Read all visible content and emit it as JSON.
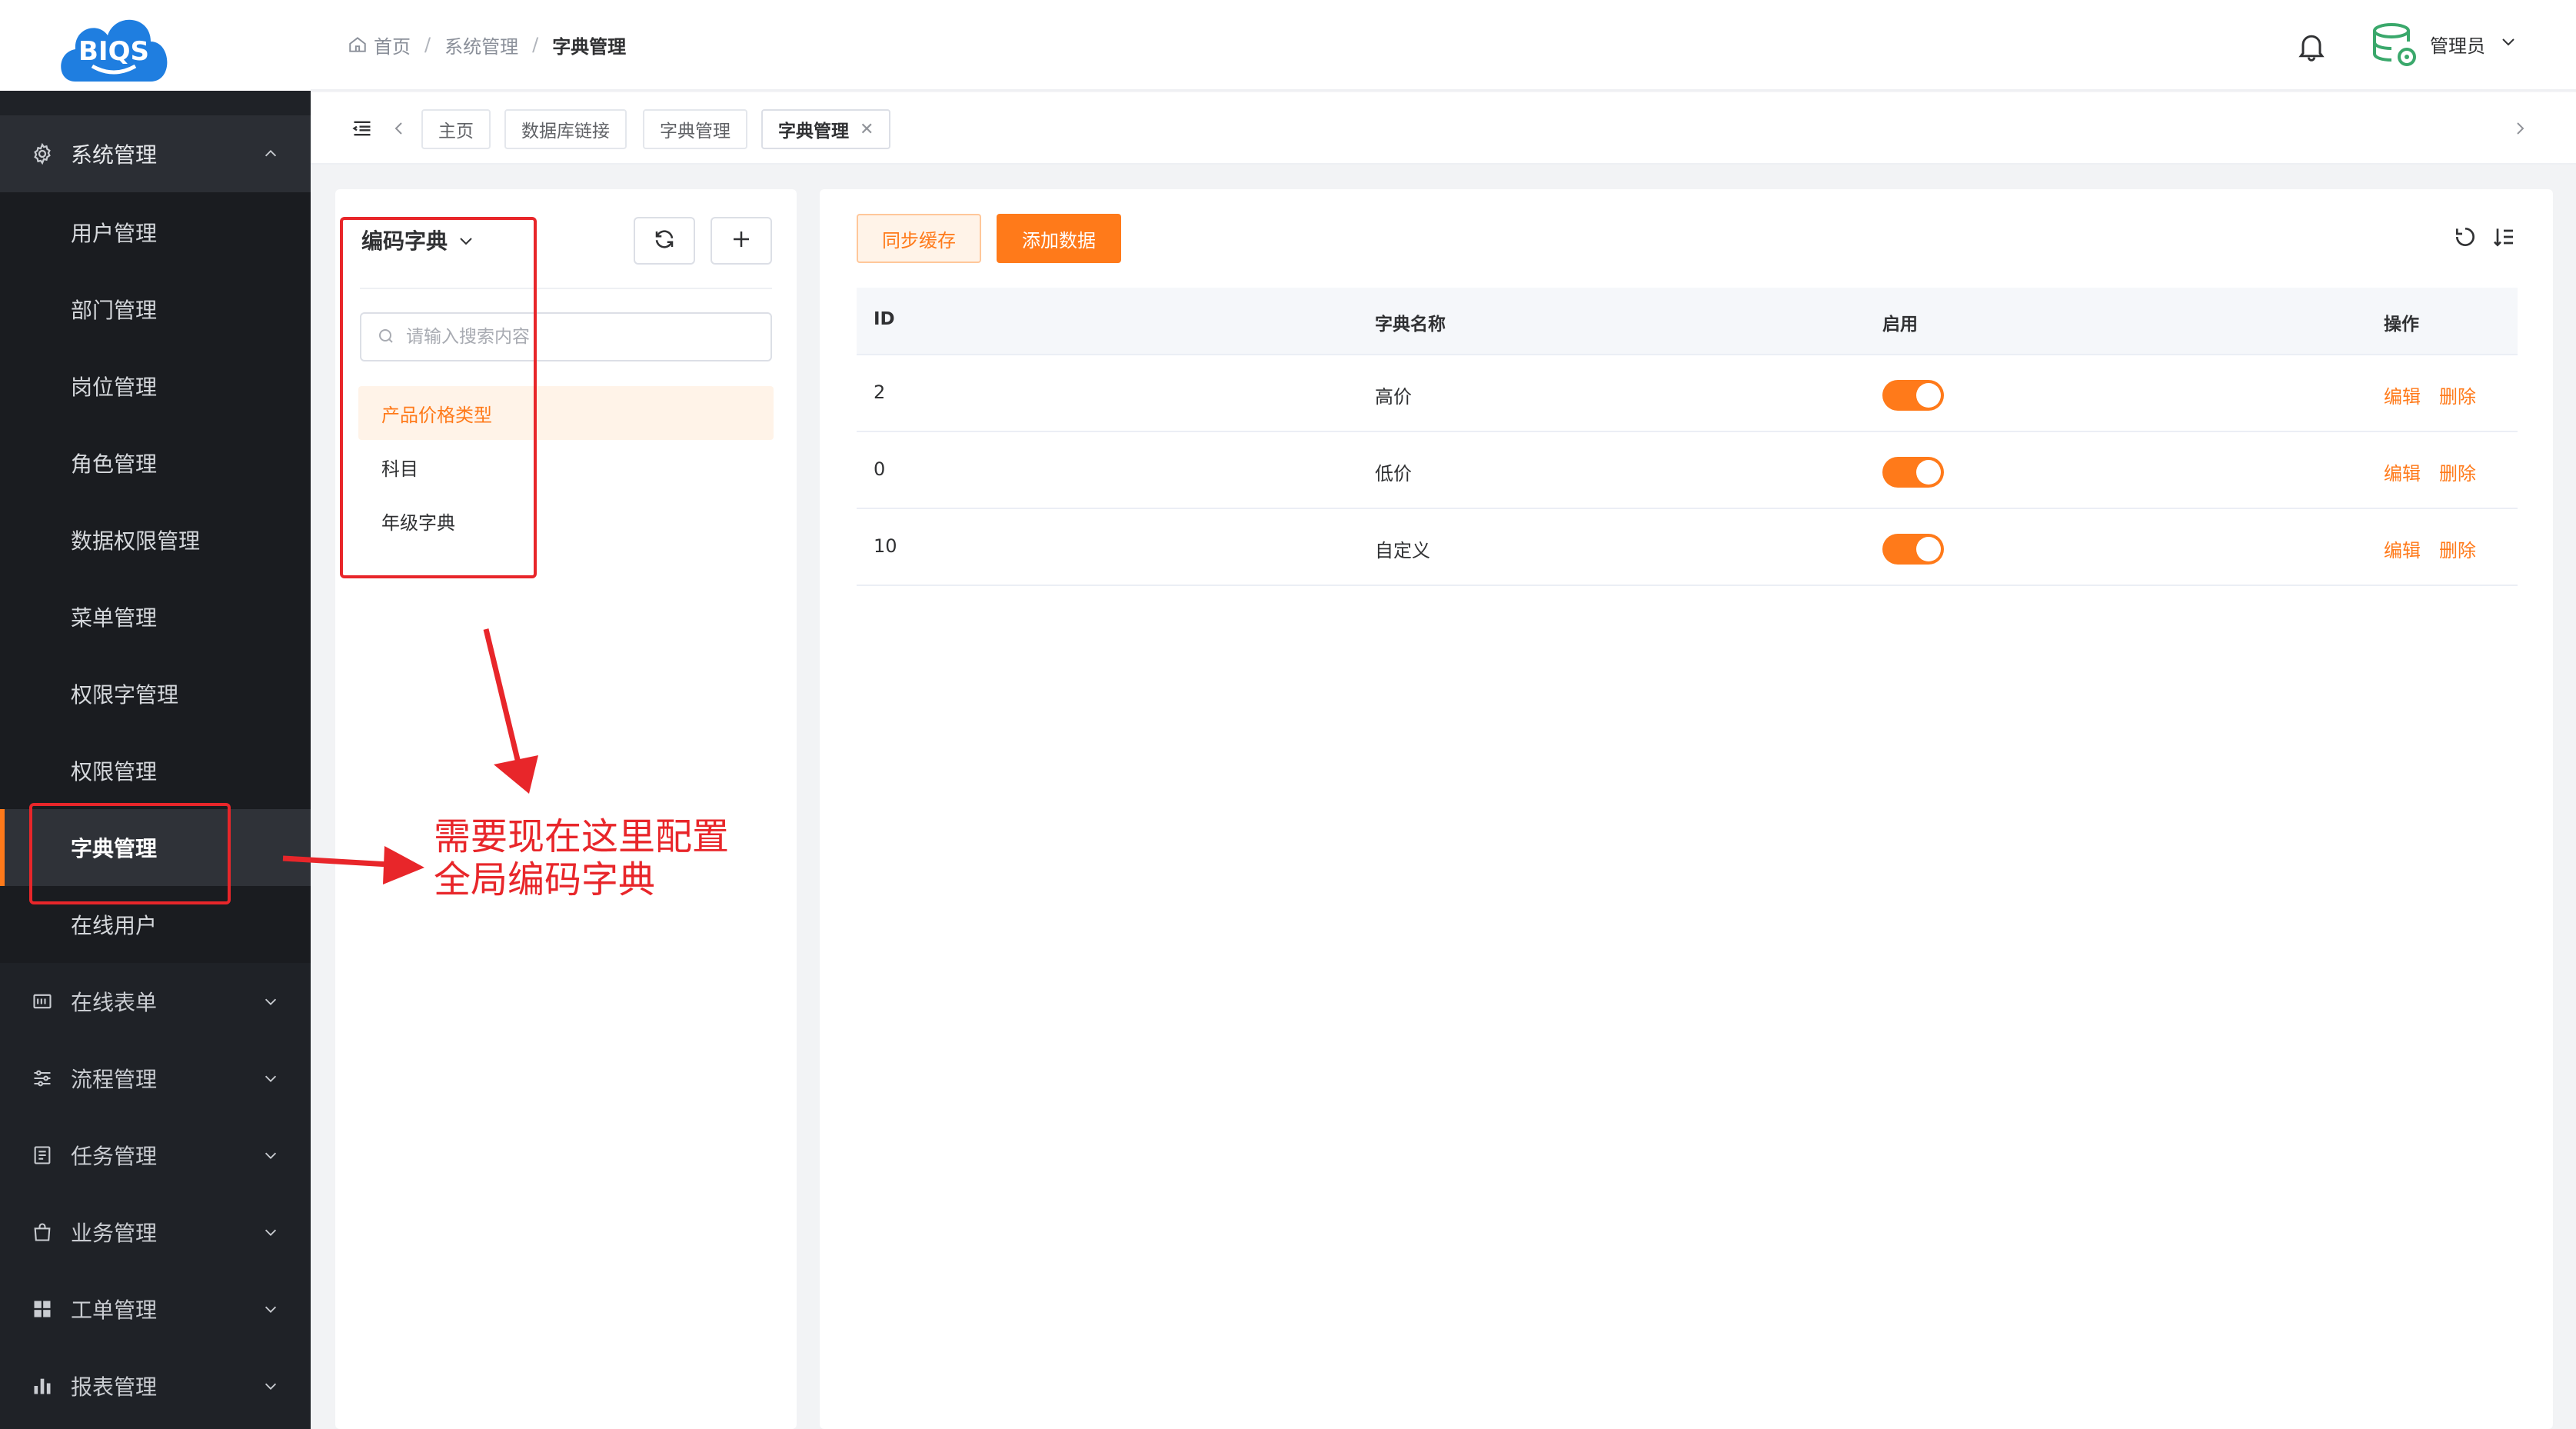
{
  "logo": {
    "text": "BIQS"
  },
  "header": {
    "breadcrumb": [
      "首页",
      "系统管理",
      "字典管理"
    ],
    "username": "管理员"
  },
  "tabs": [
    "主页",
    "数据库链接",
    "字典管理",
    "字典管理"
  ],
  "sidebar": {
    "system_group": "系统管理",
    "system_items": [
      "用户管理",
      "部门管理",
      "岗位管理",
      "角色管理",
      "数据权限管理",
      "菜单管理",
      "权限字管理",
      "权限管理",
      "字典管理",
      "在线用户"
    ],
    "groups": [
      "在线表单",
      "流程管理",
      "任务管理",
      "业务管理",
      "工单管理",
      "报表管理"
    ]
  },
  "left_panel": {
    "dict_type": "编码字典",
    "search_placeholder": "请输入搜索内容",
    "items": [
      "产品价格类型",
      "科目",
      "年级字典"
    ]
  },
  "right_panel": {
    "sync_label": "同步缓存",
    "add_label": "添加数据",
    "columns": [
      "ID",
      "字典名称",
      "启用",
      "操作"
    ],
    "rows": [
      {
        "id": "2",
        "name": "高价",
        "enabled": true
      },
      {
        "id": "0",
        "name": "低价",
        "enabled": true
      },
      {
        "id": "10",
        "name": "自定义",
        "enabled": true
      }
    ],
    "edit_label": "编辑",
    "delete_label": "删除"
  },
  "annotation": {
    "line1": "需要现在这里配置",
    "line2": "全局编码字典"
  },
  "colors": {
    "accent": "#ff7a1a",
    "sidebar": "#1f2227",
    "annotation": "#e8262a"
  }
}
